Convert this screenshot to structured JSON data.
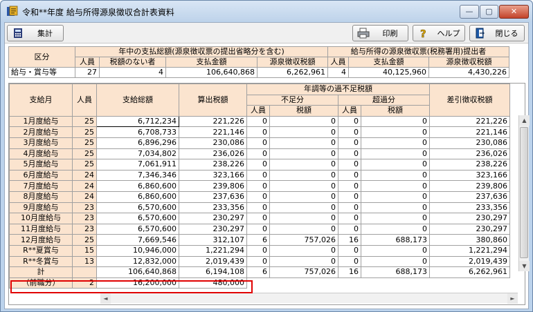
{
  "window": {
    "title": "令和**年度 給与所得源泉徴収合計表資料",
    "controls": {
      "minimize": "—",
      "maximize": "▢",
      "close": "✕"
    }
  },
  "toolbar": {
    "sum_label": "集計",
    "print_label": "印刷",
    "help_label": "ヘルプ",
    "close_label": "閉じる"
  },
  "summary": {
    "header_category": "区分",
    "group1": "年中の支払総額(源泉徴収票の提出省略分を含む)",
    "group2": "給与所得の源泉徴収票(税務署用)提出者",
    "cols": [
      "人員",
      "税額のない者",
      "支払金額",
      "源泉徴収税額",
      "人員",
      "支払金額",
      "源泉徴収税額"
    ],
    "row": {
      "label": "給与・賞与等",
      "values": [
        "27",
        "4",
        "106,640,868",
        "6,262,961",
        "4",
        "40,125,960",
        "4,430,226"
      ]
    }
  },
  "detail": {
    "h_month": "支給月",
    "h_people": "人員",
    "h_total": "支給総額",
    "h_tax": "算出税額",
    "h_yearend": "年調等の過不足税額",
    "h_short": "不足分",
    "h_over": "超過分",
    "h_people2": "人員",
    "h_taxamt": "税額",
    "h_people3": "人員",
    "h_taxamt2": "税額",
    "h_net": "差引徴収税額",
    "rows": [
      {
        "label": "1月度給与",
        "people": "25",
        "total": "6,712,234",
        "tax": "221,226",
        "sp": "0",
        "st": "0",
        "op": "0",
        "ot": "0",
        "net": "221,226"
      },
      {
        "label": "2月度給与",
        "people": "25",
        "total": "6,708,733",
        "tax": "221,146",
        "sp": "0",
        "st": "0",
        "op": "0",
        "ot": "0",
        "net": "221,146"
      },
      {
        "label": "3月度給与",
        "people": "25",
        "total": "6,896,296",
        "tax": "230,086",
        "sp": "0",
        "st": "0",
        "op": "0",
        "ot": "0",
        "net": "230,086"
      },
      {
        "label": "4月度給与",
        "people": "25",
        "total": "7,034,802",
        "tax": "236,026",
        "sp": "0",
        "st": "0",
        "op": "0",
        "ot": "0",
        "net": "236,026"
      },
      {
        "label": "5月度給与",
        "people": "25",
        "total": "7,061,911",
        "tax": "238,226",
        "sp": "0",
        "st": "0",
        "op": "0",
        "ot": "0",
        "net": "238,226"
      },
      {
        "label": "6月度給与",
        "people": "24",
        "total": "7,346,346",
        "tax": "323,166",
        "sp": "0",
        "st": "0",
        "op": "0",
        "ot": "0",
        "net": "323,166"
      },
      {
        "label": "7月度給与",
        "people": "24",
        "total": "6,860,600",
        "tax": "239,806",
        "sp": "0",
        "st": "0",
        "op": "0",
        "ot": "0",
        "net": "239,806"
      },
      {
        "label": "8月度給与",
        "people": "24",
        "total": "6,860,600",
        "tax": "237,636",
        "sp": "0",
        "st": "0",
        "op": "0",
        "ot": "0",
        "net": "237,636"
      },
      {
        "label": "9月度給与",
        "people": "23",
        "total": "6,570,600",
        "tax": "233,356",
        "sp": "0",
        "st": "0",
        "op": "0",
        "ot": "0",
        "net": "233,356"
      },
      {
        "label": "10月度給与",
        "people": "23",
        "total": "6,570,600",
        "tax": "230,297",
        "sp": "0",
        "st": "0",
        "op": "0",
        "ot": "0",
        "net": "230,297"
      },
      {
        "label": "11月度給与",
        "people": "23",
        "total": "6,570,600",
        "tax": "230,297",
        "sp": "0",
        "st": "0",
        "op": "0",
        "ot": "0",
        "net": "230,297"
      },
      {
        "label": "12月度給与",
        "people": "25",
        "total": "7,669,546",
        "tax": "312,107",
        "sp": "6",
        "st": "757,026",
        "op": "16",
        "ot": "688,173",
        "net": "380,860"
      },
      {
        "label": "R**夏賞与",
        "people": "15",
        "total": "10,946,000",
        "tax": "1,221,294",
        "sp": "0",
        "st": "0",
        "op": "0",
        "ot": "0",
        "net": "1,221,294"
      },
      {
        "label": "R**冬賞与",
        "people": "13",
        "total": "12,832,000",
        "tax": "2,019,439",
        "sp": "0",
        "st": "0",
        "op": "0",
        "ot": "0",
        "net": "2,019,439"
      }
    ],
    "total": {
      "label": "計",
      "people": "",
      "total": "106,640,868",
      "tax": "6,194,108",
      "sp": "6",
      "st": "757,026",
      "op": "16",
      "ot": "688,173",
      "net": "6,262,961"
    },
    "previous": {
      "label": "（前職分）",
      "people": "2",
      "total": "16,200,000",
      "tax": "480,000"
    }
  },
  "scroll": {
    "up": "▲",
    "down": "▼",
    "left": "◄",
    "right": "►"
  },
  "colors": {
    "header_bg": "#fbe4cf",
    "highlight": "#e00000",
    "title_bg": "#bed3ea"
  }
}
